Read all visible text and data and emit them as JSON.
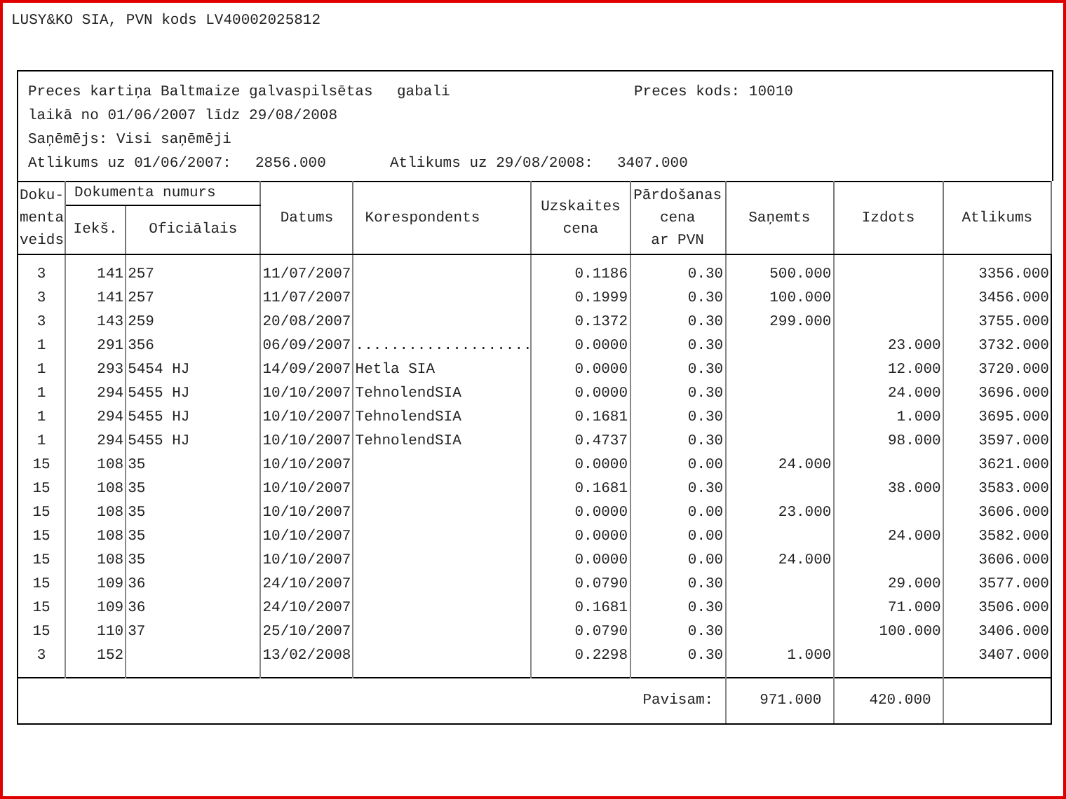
{
  "company": "LUSY&KO SIA, PVN kods LV40002025812",
  "card": {
    "title": "Preces kartiņa Baltmaize galvaspilsētas",
    "unit": "gabali",
    "code": "Preces kods: 10010",
    "period": "laikā no 01/06/2007 līdz 29/08/2008",
    "recipient": "Saņēmējs: Visi saņēmēji",
    "opening_label": "Atlikums uz 01/06/2007:",
    "opening_value": "2856.000",
    "closing_label": "Atlikums uz 29/08/2008:",
    "closing_value": "3407.000"
  },
  "columns": {
    "veids": [
      "Doku-",
      "menta",
      "veids"
    ],
    "numurs": [
      "Dokumenta numurs"
    ],
    "ieks": [
      "Iekš."
    ],
    "oficialais": [
      "Oficiālais"
    ],
    "datums": [
      "Datums"
    ],
    "korespondents": [
      "Korespondents"
    ],
    "uzskaites_cena": [
      "Uzskaites",
      "cena"
    ],
    "pardosanas_cena": [
      "Pārdošanas",
      "cena",
      "ar PVN"
    ],
    "sanemts": [
      "Saņemts"
    ],
    "izdots": [
      "Izdots"
    ],
    "atlikums": [
      "Atlikums"
    ]
  },
  "rows": [
    {
      "veids": "3",
      "ieks": "141",
      "oficialais": "257",
      "datums": "11/07/2007",
      "uzskaites_cena": "0.1186",
      "pardosanas_cena": "0.30",
      "sanemts": "500.000",
      "atlikums": "3356.000"
    },
    {
      "veids": "3",
      "ieks": "141",
      "oficialais": "257",
      "datums": "11/07/2007",
      "uzskaites_cena": "0.1999",
      "pardosanas_cena": "0.30",
      "sanemts": "100.000",
      "atlikums": "3456.000"
    },
    {
      "veids": "3",
      "ieks": "143",
      "oficialais": "259",
      "datums": "20/08/2007",
      "uzskaites_cena": "0.1372",
      "pardosanas_cena": "0.30",
      "sanemts": "299.000",
      "atlikums": "3755.000"
    },
    {
      "veids": "1",
      "ieks": "291",
      "oficialais": "356",
      "datums": "06/09/2007",
      "korespondents": "....................",
      "uzskaites_cena": "0.0000",
      "pardosanas_cena": "0.30",
      "izdots": "23.000",
      "atlikums": "3732.000"
    },
    {
      "veids": "1",
      "ieks": "293",
      "oficialais": "5454 HJ",
      "datums": "14/09/2007",
      "korespondents": "Hetla SIA",
      "uzskaites_cena": "0.0000",
      "pardosanas_cena": "0.30",
      "izdots": "12.000",
      "atlikums": "3720.000"
    },
    {
      "veids": "1",
      "ieks": "294",
      "oficialais": "5455 HJ",
      "datums": "10/10/2007",
      "korespondents": "TehnolendSIA",
      "uzskaites_cena": "0.0000",
      "pardosanas_cena": "0.30",
      "izdots": "24.000",
      "atlikums": "3696.000"
    },
    {
      "veids": "1",
      "ieks": "294",
      "oficialais": "5455 HJ",
      "datums": "10/10/2007",
      "korespondents": "TehnolendSIA",
      "uzskaites_cena": "0.1681",
      "pardosanas_cena": "0.30",
      "izdots": "1.000",
      "atlikums": "3695.000"
    },
    {
      "veids": "1",
      "ieks": "294",
      "oficialais": "5455 HJ",
      "datums": "10/10/2007",
      "korespondents": "TehnolendSIA",
      "uzskaites_cena": "0.4737",
      "pardosanas_cena": "0.30",
      "izdots": "98.000",
      "atlikums": "3597.000"
    },
    {
      "veids": "15",
      "ieks": "108",
      "oficialais": "35",
      "datums": "10/10/2007",
      "uzskaites_cena": "0.0000",
      "pardosanas_cena": "0.00",
      "sanemts": "24.000",
      "atlikums": "3621.000"
    },
    {
      "veids": "15",
      "ieks": "108",
      "oficialais": "35",
      "datums": "10/10/2007",
      "uzskaites_cena": "0.1681",
      "pardosanas_cena": "0.30",
      "izdots": "38.000",
      "atlikums": "3583.000"
    },
    {
      "veids": "15",
      "ieks": "108",
      "oficialais": "35",
      "datums": "10/10/2007",
      "uzskaites_cena": "0.0000",
      "pardosanas_cena": "0.00",
      "sanemts": "23.000",
      "atlikums": "3606.000"
    },
    {
      "veids": "15",
      "ieks": "108",
      "oficialais": "35",
      "datums": "10/10/2007",
      "uzskaites_cena": "0.0000",
      "pardosanas_cena": "0.00",
      "izdots": "24.000",
      "atlikums": "3582.000"
    },
    {
      "veids": "15",
      "ieks": "108",
      "oficialais": "35",
      "datums": "10/10/2007",
      "uzskaites_cena": "0.0000",
      "pardosanas_cena": "0.00",
      "sanemts": "24.000",
      "atlikums": "3606.000"
    },
    {
      "veids": "15",
      "ieks": "109",
      "oficialais": "36",
      "datums": "24/10/2007",
      "uzskaites_cena": "0.0790",
      "pardosanas_cena": "0.30",
      "izdots": "29.000",
      "atlikums": "3577.000"
    },
    {
      "veids": "15",
      "ieks": "109",
      "oficialais": "36",
      "datums": "24/10/2007",
      "uzskaites_cena": "0.1681",
      "pardosanas_cena": "0.30",
      "izdots": "71.000",
      "atlikums": "3506.000"
    },
    {
      "veids": "15",
      "ieks": "110",
      "oficialais": "37",
      "datums": "25/10/2007",
      "uzskaites_cena": "0.0790",
      "pardosanas_cena": "0.30",
      "izdots": "100.000",
      "atlikums": "3406.000"
    },
    {
      "veids": "3",
      "ieks": "152",
      "datums": "13/02/2008",
      "uzskaites_cena": "0.2298",
      "pardosanas_cena": "0.30",
      "sanemts": "1.000",
      "atlikums": "3407.000"
    }
  ],
  "totals": {
    "label": "Pavisam:",
    "sanemts": "971.000",
    "izdots": "420.000"
  }
}
